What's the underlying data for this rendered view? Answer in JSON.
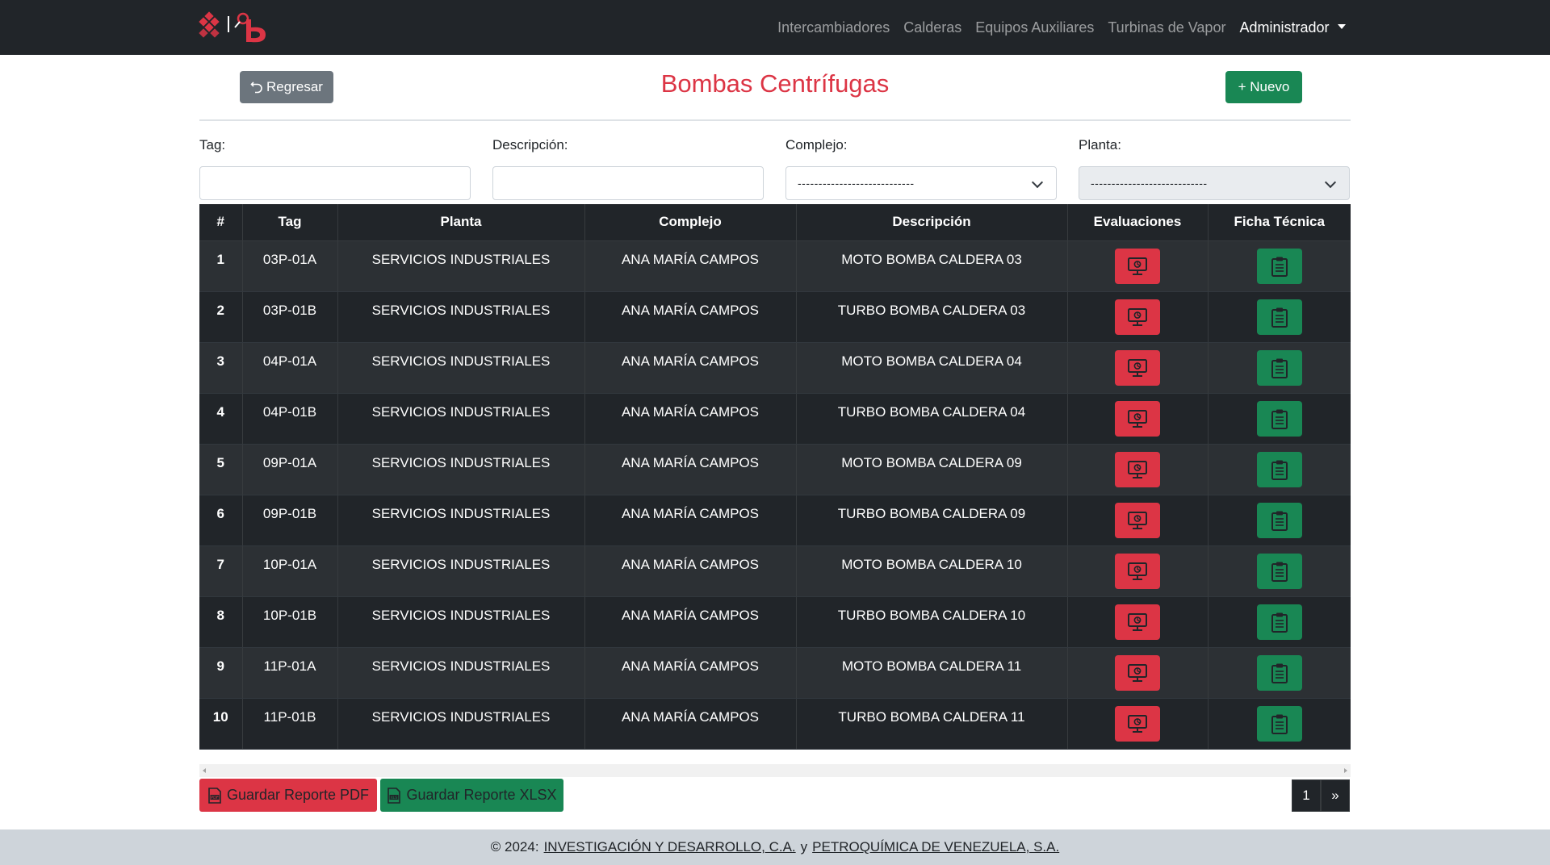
{
  "colors": {
    "navbar": "#212529",
    "danger": "#dc3545",
    "success": "#198754",
    "secondary": "#6c757d",
    "table_dark": "#212529",
    "table_striped": "#2c3034",
    "footer": "#ced4da"
  },
  "navbar": {
    "logo_icon": "pequiven-logo-icon",
    "links": [
      "Intercambiadores",
      "Calderas",
      "Equipos Auxiliares",
      "Turbinas de Vapor"
    ],
    "user_menu": "Administrador"
  },
  "header": {
    "back_label": "Regresar",
    "back_icon": "undo-arrow-icon",
    "title": "Bombas Centrífugas",
    "new_label": "+ Nuevo"
  },
  "filters": {
    "tag_label": "Tag:",
    "tag_value": "",
    "description_label": "Descripción:",
    "description_value": "",
    "complex_label": "Complejo:",
    "complex_selected": "----------------------------",
    "plant_label": "Planta:",
    "plant_selected": "----------------------------"
  },
  "table": {
    "columns": [
      "#",
      "Tag",
      "Planta",
      "Complejo",
      "Descripción",
      "Evaluaciones",
      "Ficha Técnica"
    ],
    "rows": [
      {
        "n": "1",
        "tag": "03P-01A",
        "planta": "SERVICIOS INDUSTRIALES",
        "complejo": "ANA MARÍA CAMPOS",
        "descripcion": "MOTO BOMBA CALDERA 03"
      },
      {
        "n": "2",
        "tag": "03P-01B",
        "planta": "SERVICIOS INDUSTRIALES",
        "complejo": "ANA MARÍA CAMPOS",
        "descripcion": "TURBO BOMBA CALDERA 03"
      },
      {
        "n": "3",
        "tag": "04P-01A",
        "planta": "SERVICIOS INDUSTRIALES",
        "complejo": "ANA MARÍA CAMPOS",
        "descripcion": "MOTO BOMBA CALDERA 04"
      },
      {
        "n": "4",
        "tag": "04P-01B",
        "planta": "SERVICIOS INDUSTRIALES",
        "complejo": "ANA MARÍA CAMPOS",
        "descripcion": "TURBO BOMBA CALDERA 04"
      },
      {
        "n": "5",
        "tag": "09P-01A",
        "planta": "SERVICIOS INDUSTRIALES",
        "complejo": "ANA MARÍA CAMPOS",
        "descripcion": "MOTO BOMBA CALDERA 09"
      },
      {
        "n": "6",
        "tag": "09P-01B",
        "planta": "SERVICIOS INDUSTRIALES",
        "complejo": "ANA MARÍA CAMPOS",
        "descripcion": "TURBO BOMBA CALDERA 09"
      },
      {
        "n": "7",
        "tag": "10P-01A",
        "planta": "SERVICIOS INDUSTRIALES",
        "complejo": "ANA MARÍA CAMPOS",
        "descripcion": "MOTO BOMBA CALDERA 10"
      },
      {
        "n": "8",
        "tag": "10P-01B",
        "planta": "SERVICIOS INDUSTRIALES",
        "complejo": "ANA MARÍA CAMPOS",
        "descripcion": "TURBO BOMBA CALDERA 10"
      },
      {
        "n": "9",
        "tag": "11P-01A",
        "planta": "SERVICIOS INDUSTRIALES",
        "complejo": "ANA MARÍA CAMPOS",
        "descripcion": "MOTO BOMBA CALDERA 11"
      },
      {
        "n": "10",
        "tag": "11P-01B",
        "planta": "SERVICIOS INDUSTRIALES",
        "complejo": "ANA MARÍA CAMPOS",
        "descripcion": "TURBO BOMBA CALDERA 11"
      }
    ],
    "evaluation_icon": "monitor-evaluation-icon",
    "datasheet_icon": "clipboard-icon"
  },
  "reports": {
    "pdf_label": "Guardar Reporte PDF",
    "pdf_icon": "pdf-file-icon",
    "xlsx_label": "Guardar Reporte XLSX",
    "xlsx_icon": "xlsx-file-icon"
  },
  "pagination": {
    "current_page": "1",
    "next_label": "»"
  },
  "footer": {
    "prefix": "© 2024:",
    "link1": "INVESTIGACIÓN Y DESARROLLO, C.A.",
    "conjunction": "y",
    "link2": "PETROQUÍMICA DE VENEZUELA, S.A."
  }
}
